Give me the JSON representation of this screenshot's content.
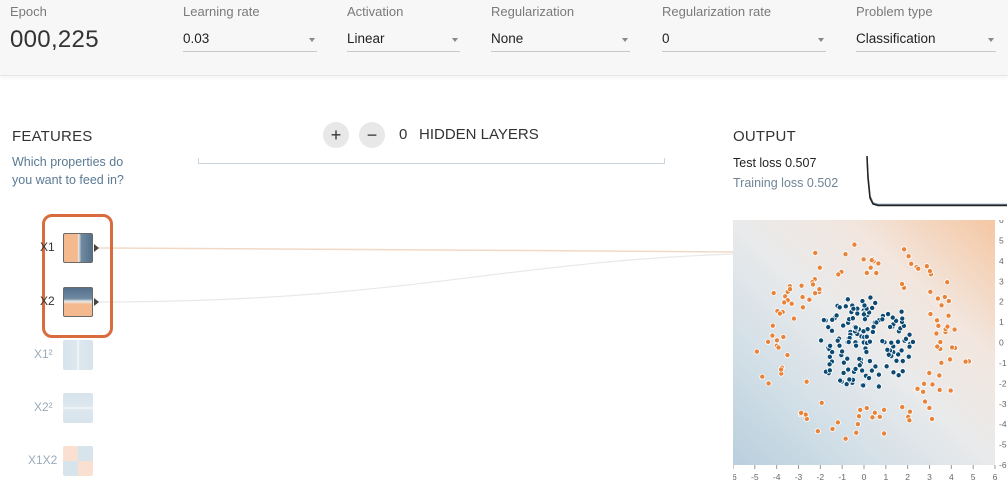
{
  "header": {
    "epoch_label": "Epoch",
    "epoch_value": "000,225",
    "learning_rate": {
      "label": "Learning rate",
      "value": "0.03"
    },
    "activation": {
      "label": "Activation",
      "value": "Linear"
    },
    "regularization": {
      "label": "Regularization",
      "value": "None"
    },
    "regularization_rate": {
      "label": "Regularization rate",
      "value": "0"
    },
    "problem_type": {
      "label": "Problem type",
      "value": "Classification"
    }
  },
  "features": {
    "title": "FEATURES",
    "subtitle_line1": "Which properties do",
    "subtitle_line2": "you want to feed in?",
    "items": [
      {
        "label": "X1",
        "active": true
      },
      {
        "label": "X2",
        "active": true
      },
      {
        "label": "X1²",
        "active": false
      },
      {
        "label": "X2²",
        "active": false
      },
      {
        "label": "X1X2",
        "active": false
      }
    ]
  },
  "hidden_layers": {
    "add_symbol": "+",
    "remove_symbol": "−",
    "count": "0",
    "label": "HIDDEN LAYERS"
  },
  "output": {
    "title": "OUTPUT",
    "test_loss_label": "Test loss",
    "test_loss_value": "0.507",
    "training_loss_label": "Training loss",
    "training_loss_value": "0.502",
    "axis_ticks": [
      "-6",
      "-5",
      "-4",
      "-3",
      "-2",
      "-1",
      "0",
      "1",
      "2",
      "3",
      "4",
      "5",
      "6"
    ]
  },
  "colors": {
    "positive": "#e8833a",
    "negative": "#0d4a73",
    "heat_orange": "#f5c7a3",
    "heat_blue": "#b9cfdd",
    "selection": "#d86c3d"
  }
}
